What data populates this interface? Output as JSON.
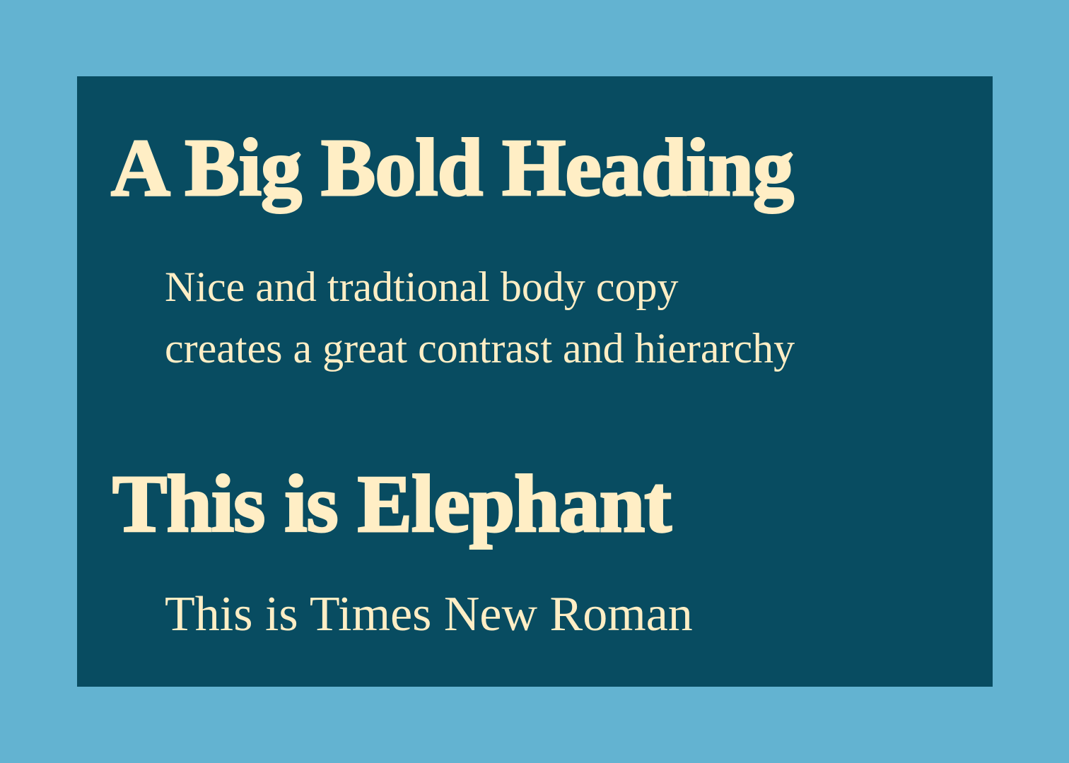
{
  "heading_1": "A Big Bold Heading",
  "body_1": {
    "line_1": "Nice and tradtional body copy",
    "line_2": "creates a great contrast and hierarchy"
  },
  "heading_2": "This is Elephant",
  "body_2": "This is Times New Roman",
  "colors": {
    "outer_background": "#63b3d1",
    "panel_background": "#084c61",
    "text": "#ffeec5"
  }
}
